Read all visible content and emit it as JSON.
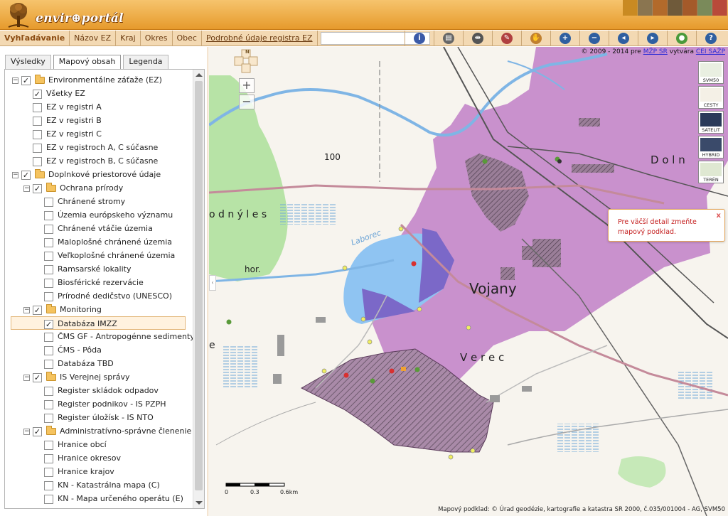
{
  "header": {
    "logo_text": "envir⊕portál"
  },
  "navbar": {
    "tabs": [
      "Vyhľadávanie",
      "Názov EZ",
      "Kraj",
      "Okres",
      "Obec",
      "Podrobné údaje registra EZ"
    ],
    "search_placeholder": ""
  },
  "tools": [
    {
      "icon": "info-icon",
      "color": "#3a5aa8"
    },
    {
      "icon": "print-icon",
      "color": "#666666"
    },
    {
      "icon": "measure-icon",
      "color": "#555555"
    },
    {
      "icon": "eraser-icon",
      "color": "#b04040"
    },
    {
      "icon": "hand-icon",
      "color": "#c08030"
    },
    {
      "icon": "zoom-in-icon",
      "color": "#2f5fa0"
    },
    {
      "icon": "zoom-out-icon",
      "color": "#2f5fa0"
    },
    {
      "icon": "zoom-previous-icon",
      "color": "#2f5fa0"
    },
    {
      "icon": "zoom-next-icon",
      "color": "#2f5fa0"
    },
    {
      "icon": "globe-icon",
      "color": "#4a9a3a"
    },
    {
      "icon": "help-icon",
      "color": "#2f5fa0"
    }
  ],
  "panel": {
    "tabs": [
      "Výsledky",
      "Mapový obsah",
      "Legenda"
    ],
    "tree": [
      {
        "label": "Environmentálne záťaže (EZ)",
        "level": 0,
        "expander": "−",
        "checked": true,
        "folder": true
      },
      {
        "label": "Všetky EZ",
        "level": 1,
        "checked": true
      },
      {
        "label": "EZ v registri A",
        "level": 1,
        "checked": false
      },
      {
        "label": "EZ v registri B",
        "level": 1,
        "checked": false
      },
      {
        "label": "EZ v registri C",
        "level": 1,
        "checked": false
      },
      {
        "label": "EZ v registroch A, C súčasne",
        "level": 1,
        "checked": false
      },
      {
        "label": "EZ v registroch B, C súčasne",
        "level": 1,
        "checked": false
      },
      {
        "label": "Doplnkové priestorové údaje",
        "level": 0,
        "expander": "−",
        "checked": true,
        "folder": true
      },
      {
        "label": "Ochrana prírody",
        "level": 1,
        "expander": "−",
        "checked": true,
        "folder": true
      },
      {
        "label": "Chránené stromy",
        "level": 2,
        "checked": false
      },
      {
        "label": "Územia európskeho významu",
        "level": 2,
        "checked": false
      },
      {
        "label": "Chránené vtáčie územia",
        "level": 2,
        "checked": false
      },
      {
        "label": "Maloplošné chránené územia",
        "level": 2,
        "checked": false
      },
      {
        "label": "Veľkoplošné chránené územia",
        "level": 2,
        "checked": false
      },
      {
        "label": "Ramsarské lokality",
        "level": 2,
        "checked": false
      },
      {
        "label": "Biosférické rezervácie",
        "level": 2,
        "checked": false
      },
      {
        "label": "Prírodné dedičstvo (UNESCO)",
        "level": 2,
        "checked": false
      },
      {
        "label": "Monitoring",
        "level": 1,
        "expander": "−",
        "checked": true,
        "folder": true
      },
      {
        "label": "Databáza IMZZ",
        "level": 2,
        "checked": true,
        "highlight": true
      },
      {
        "label": "ČMS GF - Antropogénne sedimenty",
        "level": 2,
        "checked": false
      },
      {
        "label": "ČMS - Pôda",
        "level": 2,
        "checked": false
      },
      {
        "label": "Databáza TBD",
        "level": 2,
        "checked": false
      },
      {
        "label": "IS Verejnej správy",
        "level": 1,
        "expander": "−",
        "checked": true,
        "folder": true
      },
      {
        "label": "Register skládok odpadov",
        "level": 2,
        "checked": false
      },
      {
        "label": "Register podnikov - IS PZPH",
        "level": 2,
        "checked": false
      },
      {
        "label": "Register úložísk - IS NTO",
        "level": 2,
        "checked": false
      },
      {
        "label": "Administratívno-správne členenie",
        "level": 1,
        "expander": "−",
        "checked": true,
        "folder": true
      },
      {
        "label": "Hranice obcí",
        "level": 2,
        "checked": false
      },
      {
        "label": "Hranice okresov",
        "level": 2,
        "checked": false
      },
      {
        "label": "Hranice krajov",
        "level": 2,
        "checked": false
      },
      {
        "label": "KN - Katastrálna mapa (C)",
        "level": 2,
        "checked": false
      },
      {
        "label": "KN - Mapa určeného operátu (E)",
        "level": 2,
        "checked": false
      }
    ]
  },
  "map": {
    "copyright_prefix": "© 2009 - 2014 pre",
    "copyright_link1": "MŽP SR",
    "copyright_middle": "vytvára",
    "copyright_link2": "CEI SAŽP",
    "attribution": "Mapový podklad: © Úrad geodézie, kartografie a katastra SR 2000, č.035/001004 - AG, SVM50",
    "zoom_in": "+",
    "zoom_out": "−",
    "basemaps": [
      "SVM50",
      "CESTY",
      "SATELIT",
      "HYBRID",
      "TERÉN"
    ],
    "info_text": "Pre väčší detail zmeňte mapový podklad.",
    "info_close": "x",
    "labels": {
      "vojany": "Vojany",
      "verec": "V e r e c",
      "doln": "D o l n",
      "les": "o d n ý   l e s",
      "laborec": "Laborec",
      "hor": "hor.",
      "elev": "100",
      "e_edge": "e"
    },
    "scale": {
      "t0": "0",
      "t1": "0.3",
      "t2": "0.6km"
    },
    "compass": "N"
  },
  "colors": {
    "accent": "#e69a2c",
    "purple_zone": "#b77bc0",
    "water": "#8fc4f2",
    "forest": "#b7e3a6",
    "info_text": "#c52121"
  }
}
